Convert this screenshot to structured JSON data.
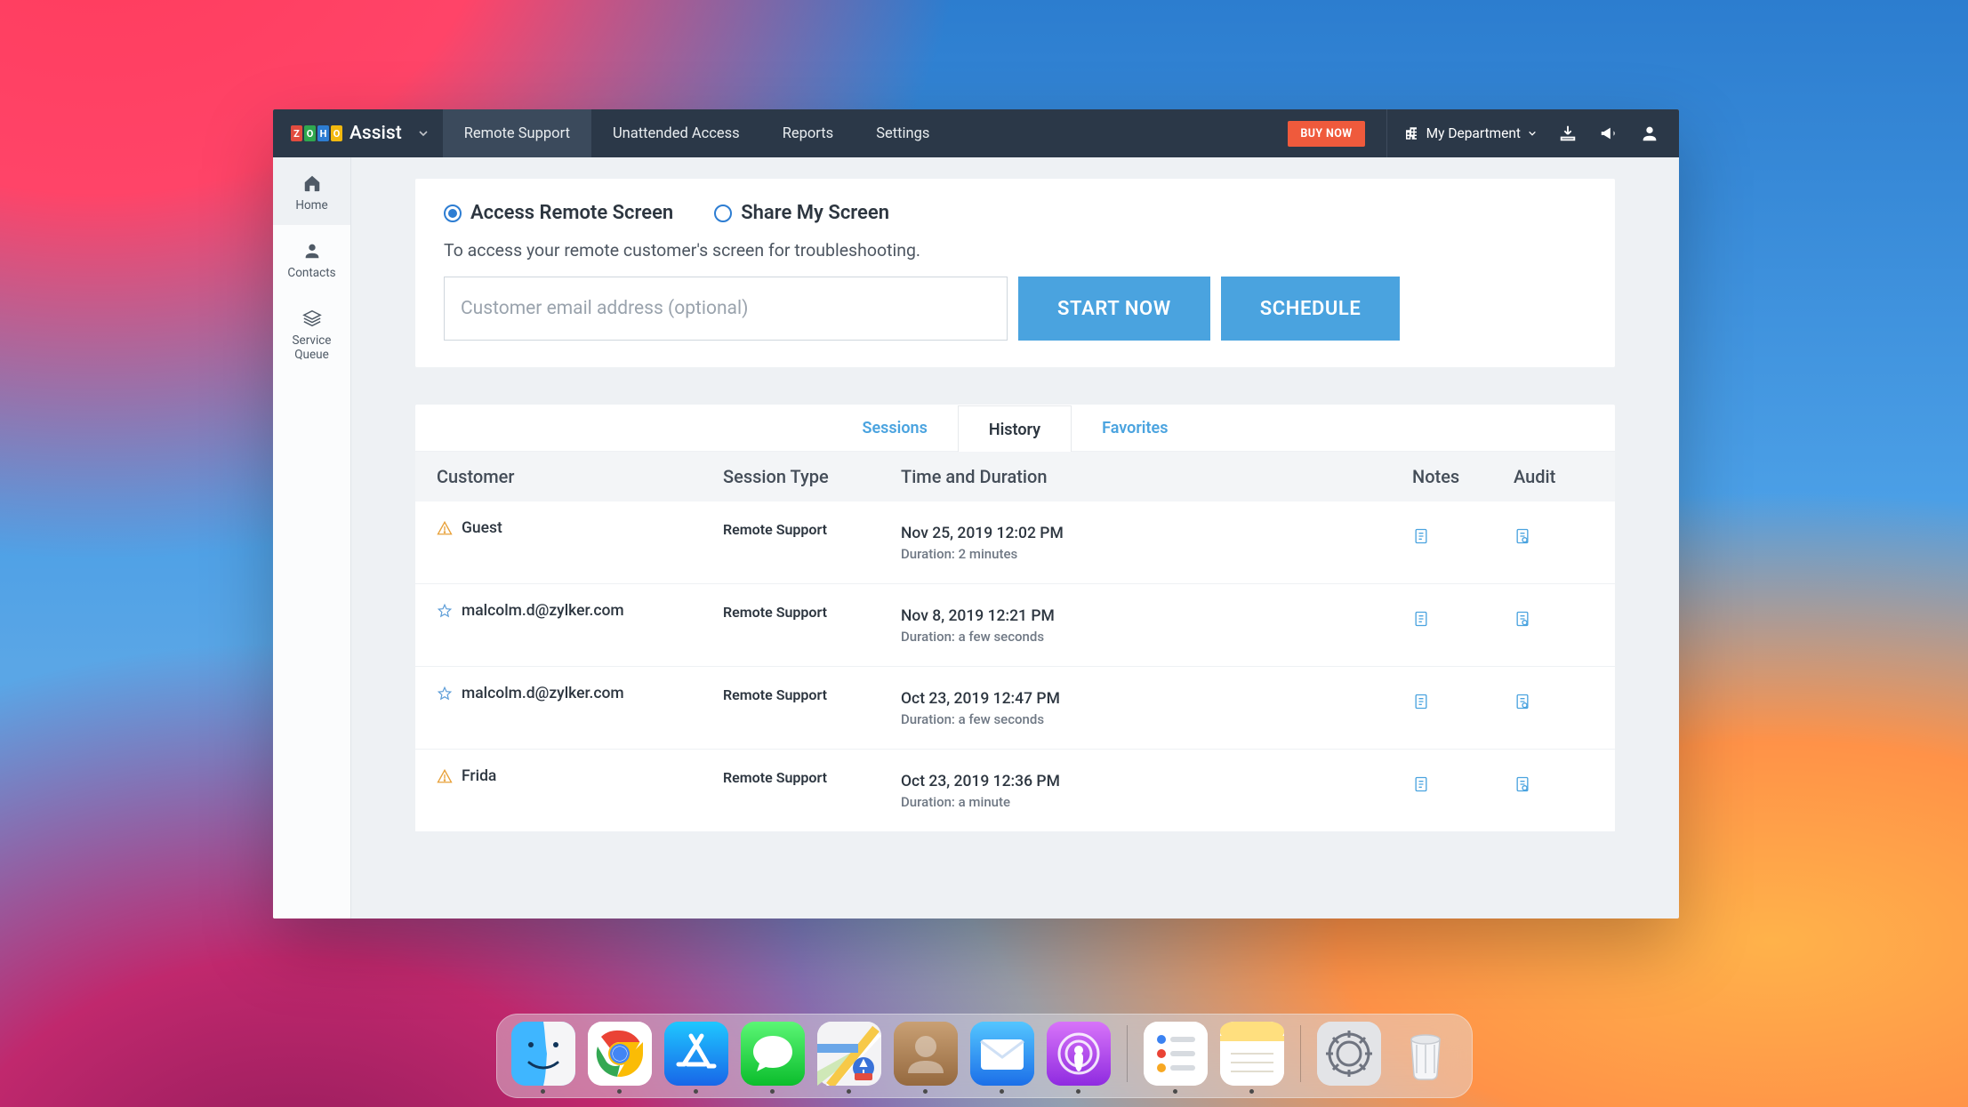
{
  "brand": {
    "name": "Assist",
    "tiles": [
      "Z",
      "O",
      "H",
      "O"
    ]
  },
  "topnav": {
    "tabs": [
      {
        "label": "Remote Support",
        "active": true
      },
      {
        "label": "Unattended Access",
        "active": false
      },
      {
        "label": "Reports",
        "active": false
      },
      {
        "label": "Settings",
        "active": false
      }
    ],
    "buy_now": "BUY NOW",
    "department": "My Department"
  },
  "sidebar": {
    "items": [
      {
        "label": "Home",
        "icon": "home",
        "active": true
      },
      {
        "label": "Contacts",
        "icon": "user",
        "active": false
      },
      {
        "label": "Service Queue",
        "icon": "stack",
        "active": false
      }
    ]
  },
  "access_card": {
    "radios": {
      "access": "Access Remote Screen",
      "share": "Share My Screen"
    },
    "description": "To access your remote customer's screen for troubleshooting.",
    "placeholder": "Customer email address (optional)",
    "start_btn": "START NOW",
    "schedule_btn": "SCHEDULE"
  },
  "history": {
    "tabs": {
      "sessions": "Sessions",
      "history": "History",
      "favorites": "Favorites"
    },
    "columns": {
      "customer": "Customer",
      "type": "Session Type",
      "time": "Time and Duration",
      "notes": "Notes",
      "audit": "Audit"
    },
    "rows": [
      {
        "icon": "warn",
        "customer": "Guest",
        "type": "Remote Support",
        "time": "Nov 25, 2019 12:02 PM",
        "duration": "Duration: 2 minutes"
      },
      {
        "icon": "star",
        "customer": "malcolm.d@zylker.com",
        "type": "Remote Support",
        "time": "Nov 8, 2019 12:21 PM",
        "duration": "Duration: a few seconds"
      },
      {
        "icon": "star",
        "customer": "malcolm.d@zylker.com",
        "type": "Remote Support",
        "time": "Oct 23, 2019 12:47 PM",
        "duration": "Duration: a few seconds"
      },
      {
        "icon": "warn",
        "customer": "Frida",
        "type": "Remote Support",
        "time": "Oct 23, 2019 12:36 PM",
        "duration": "Duration: a minute"
      }
    ]
  },
  "dock": {
    "left": [
      "finder",
      "chrome",
      "appstore",
      "messages",
      "maps",
      "contacts",
      "mail",
      "podcasts"
    ],
    "right": [
      "reminders",
      "notes"
    ],
    "far": [
      "settings",
      "trash"
    ]
  }
}
